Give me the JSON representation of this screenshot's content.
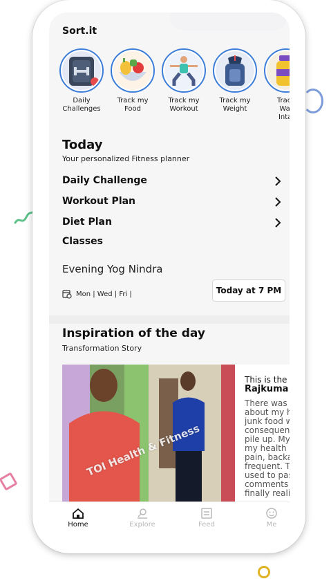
{
  "app": {
    "title": "Sort.it"
  },
  "stories": [
    {
      "line1": "Daily",
      "line2": "Challenges",
      "icon": "dumbbell-icon"
    },
    {
      "line1": "Track my",
      "line2": "Food",
      "icon": "food-bowl-icon"
    },
    {
      "line1": "Track my",
      "line2": "Workout",
      "icon": "workout-person-icon"
    },
    {
      "line1": "Track my",
      "line2": "Weight",
      "icon": "weight-scale-icon"
    },
    {
      "line1": "Track",
      "line2": "Wat",
      "line3": "Intal",
      "icon": "water-bottle-icon"
    }
  ],
  "today": {
    "title": "Today",
    "subtitle": "Your personalized Fitness planner",
    "items": [
      {
        "label": "Daily Challenge"
      },
      {
        "label": "Workout Plan"
      },
      {
        "label": "Diet Plan"
      },
      {
        "label": "Classes"
      }
    ],
    "class": {
      "name": "Evening Yog Nindra",
      "days": "Mon | Wed | Fri |",
      "time_button": "Today at 7 PM"
    }
  },
  "inspiration": {
    "title": "Inspiration of the day",
    "subtitle": "Transformation Story",
    "intro": "This is the",
    "name": "Rajkuma",
    "body": "There was a about my he junk food w consequenc pile up. My my health h pain, backa frequent. Th used to pas comments a finally realiz",
    "watermark": "TOI Health & Fitness"
  },
  "nav": [
    {
      "label": "Home",
      "icon": "home-icon",
      "active": true
    },
    {
      "label": "Explore",
      "icon": "explore-icon",
      "active": false
    },
    {
      "label": "Feed",
      "icon": "feed-icon",
      "active": false
    },
    {
      "label": "Me",
      "icon": "smiley-icon",
      "active": false
    }
  ],
  "colors": {
    "accent": "#3b7dd8",
    "text": "#111111",
    "inactive": "#b8b8b8"
  }
}
